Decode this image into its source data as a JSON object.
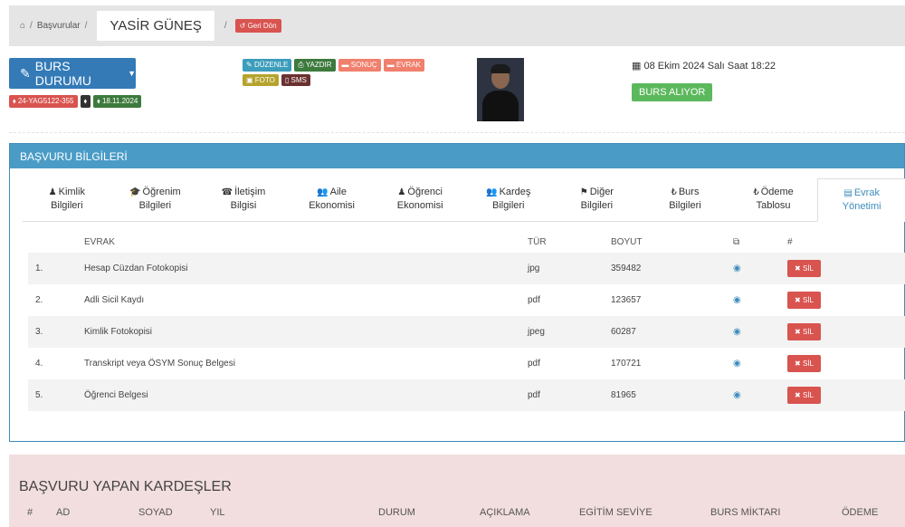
{
  "breadcrumb": {
    "home_icon": "home-icon",
    "applications": "Başvurular",
    "name": "YASİR GÜNEŞ",
    "back": "Geri Dön"
  },
  "status": {
    "label": "BURS DURUMU"
  },
  "tags": [
    {
      "text": "24-YAG5122-355",
      "color": "#d9534f"
    },
    {
      "text": "",
      "color": "#333333"
    },
    {
      "text": "18.11.2024",
      "color": "#3d7a3d"
    }
  ],
  "actions": [
    {
      "label": "DÜZENLE",
      "color": "#3c9dbc",
      "icon": "pencil-icon"
    },
    {
      "label": "YAZDIR",
      "color": "#3d7a3d",
      "icon": "print-icon"
    },
    {
      "label": "SONUÇ",
      "color": "#f0806d",
      "icon": "folder-icon"
    },
    {
      "label": "EVRAK",
      "color": "#f0806d",
      "icon": "folder-icon"
    },
    {
      "label": "FOTO",
      "color": "#b5a32c",
      "icon": "image-icon"
    },
    {
      "label": "SMS",
      "color": "#6b3030",
      "icon": "mobile-icon"
    }
  ],
  "date": "08 Ekim 2024 Salı Saat 18:22",
  "result": "BURS ALIYOR",
  "panel": {
    "title": "BAŞVURU BİLGİLERİ"
  },
  "tabs": [
    {
      "line1": "Kimlik",
      "line2": "Bilgileri",
      "icon": "user-icon",
      "glyph": "♟"
    },
    {
      "line1": "Öğrenim",
      "line2": "Bilgileri",
      "icon": "graduation-cap-icon",
      "glyph": "🎓"
    },
    {
      "line1": "İletişim",
      "line2": "Bilgisi",
      "icon": "phone-icon",
      "glyph": "☎"
    },
    {
      "line1": "Aile",
      "line2": "Ekonomisi",
      "icon": "users-icon",
      "glyph": "👥"
    },
    {
      "line1": "Öğrenci",
      "line2": "Ekonomisi",
      "icon": "user-icon",
      "glyph": "♟"
    },
    {
      "line1": "Kardeş",
      "line2": "Bilgileri",
      "icon": "users-icon",
      "glyph": "👥"
    },
    {
      "line1": "Diğer",
      "line2": "Bilgileri",
      "icon": "flag-icon",
      "glyph": "⚑"
    },
    {
      "line1": "Burs",
      "line2": "Bilgileri",
      "icon": "lira-icon",
      "glyph": "₺"
    },
    {
      "line1": "Ödeme",
      "line2": "Tablosu",
      "icon": "lira-icon",
      "glyph": "₺"
    },
    {
      "line1": "Evrak",
      "line2": "Yönetimi",
      "icon": "file-icon",
      "glyph": "▤"
    }
  ],
  "table": {
    "headers": {
      "doc": "EVRAK",
      "type": "TÜR",
      "size": "BOYUT",
      "hash": "#"
    },
    "delete_label": "SİL",
    "rows": [
      {
        "num": "1.",
        "doc": "Hesap Cüzdan Fotokopisi",
        "type": "jpg",
        "size": "359482"
      },
      {
        "num": "2.",
        "doc": "Adli Sicil Kaydı",
        "type": "pdf",
        "size": "123657"
      },
      {
        "num": "3.",
        "doc": "Kimlik Fotokopisi",
        "type": "jpeg",
        "size": "60287"
      },
      {
        "num": "4.",
        "doc": "Transkript veya ÖSYM Sonuç Belgesi",
        "type": "pdf",
        "size": "170721"
      },
      {
        "num": "5.",
        "doc": "Öğrenci Belgesi",
        "type": "pdf",
        "size": "81965"
      }
    ]
  },
  "siblings": {
    "title": "BAŞVURU YAPAN KARDEŞLER",
    "columns": [
      "#",
      "AD",
      "SOYAD",
      "YIL",
      "DURUM",
      "AÇIKLAMA",
      "EGİTİM SEVİYE",
      "BURS MİKTARI",
      "ÖDEME"
    ]
  }
}
